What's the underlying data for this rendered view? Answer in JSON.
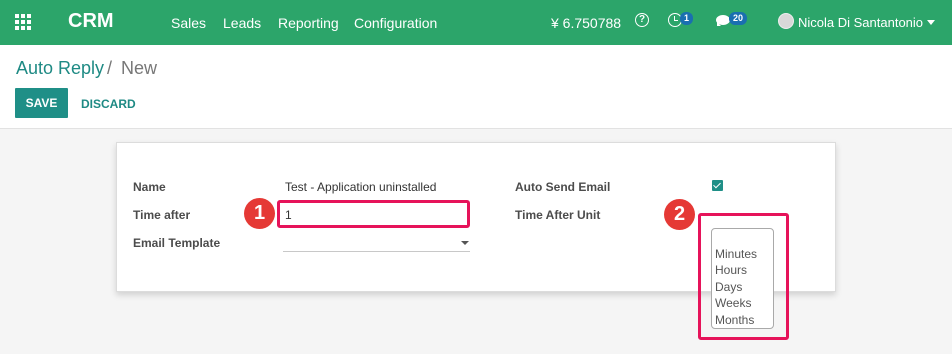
{
  "topbar": {
    "brand": "CRM",
    "menus": [
      "Sales",
      "Leads",
      "Reporting",
      "Configuration"
    ],
    "currency": "¥ 6.750788",
    "activity_count": "1",
    "message_count": "20",
    "user_name": "Nicola Di Santantonio",
    "bar_color": "#2ca56a"
  },
  "breadcrumb": {
    "root": "Auto Reply",
    "separator": "/",
    "current": "New"
  },
  "buttons": {
    "save": "SAVE",
    "discard": "DISCARD"
  },
  "form": {
    "name_label": "Name",
    "name_value": "Test - Application uninstalled",
    "time_after_label": "Time after",
    "time_after_value": "1",
    "email_template_label": "Email Template",
    "email_template_value": "",
    "auto_send_label": "Auto Send Email",
    "auto_send_checked": true,
    "time_after_unit_label": "Time After Unit",
    "time_after_unit_options": [
      "",
      "Minutes",
      "Hours",
      "Days",
      "Weeks",
      "Months"
    ]
  },
  "annotations": {
    "marker_1": "1",
    "marker_2": "2",
    "highlight_color": "#e6135a"
  }
}
